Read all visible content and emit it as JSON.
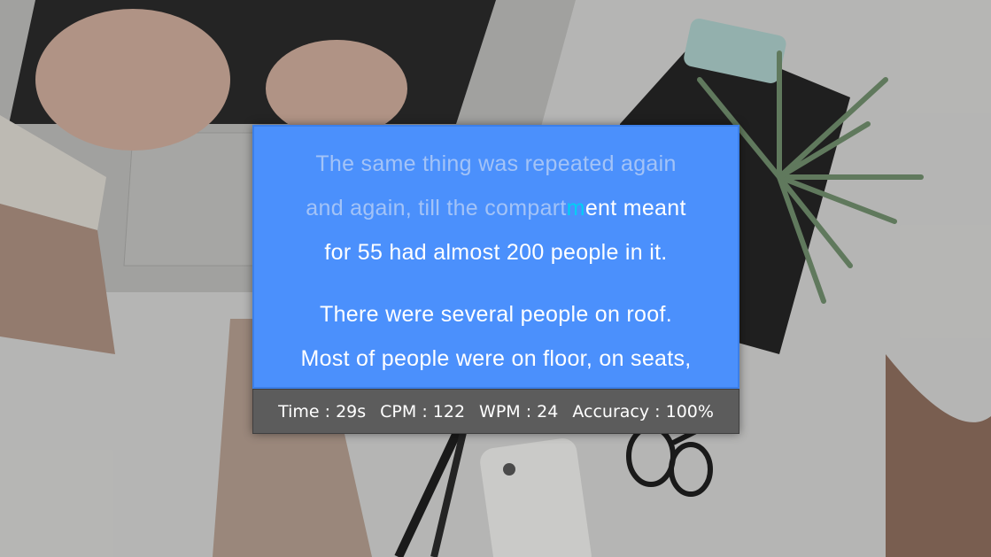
{
  "passage": {
    "line1": {
      "typed": "The same thing was repeated again"
    },
    "line2": {
      "typed": "and again, till the compart",
      "current": "m",
      "remaining": "ent meant"
    },
    "line3": {
      "remaining": "for 55 had almost 200 people in it."
    },
    "line4": {
      "remaining": "There were several people on roof."
    },
    "line5": {
      "remaining": "Most of people were on floor, on seats,"
    }
  },
  "stats": {
    "time_label": "Time",
    "time_value": "29s",
    "cpm_label": "CPM",
    "cpm_value": "122",
    "wpm_label": "WPM",
    "wpm_value": "24",
    "accuracy_label": "Accuracy",
    "accuracy_value": "100%",
    "separator": ":"
  },
  "colors": {
    "panel_bg": "#4b90fc",
    "typed_text": "#a3c3f7",
    "current_char": "#00d0f5",
    "untyped_text": "#ffffff",
    "stats_bg": "#5c5c5c"
  },
  "icons": [
    "laptop-photo",
    "plant-photo",
    "phone-photo",
    "glasses-photo"
  ]
}
